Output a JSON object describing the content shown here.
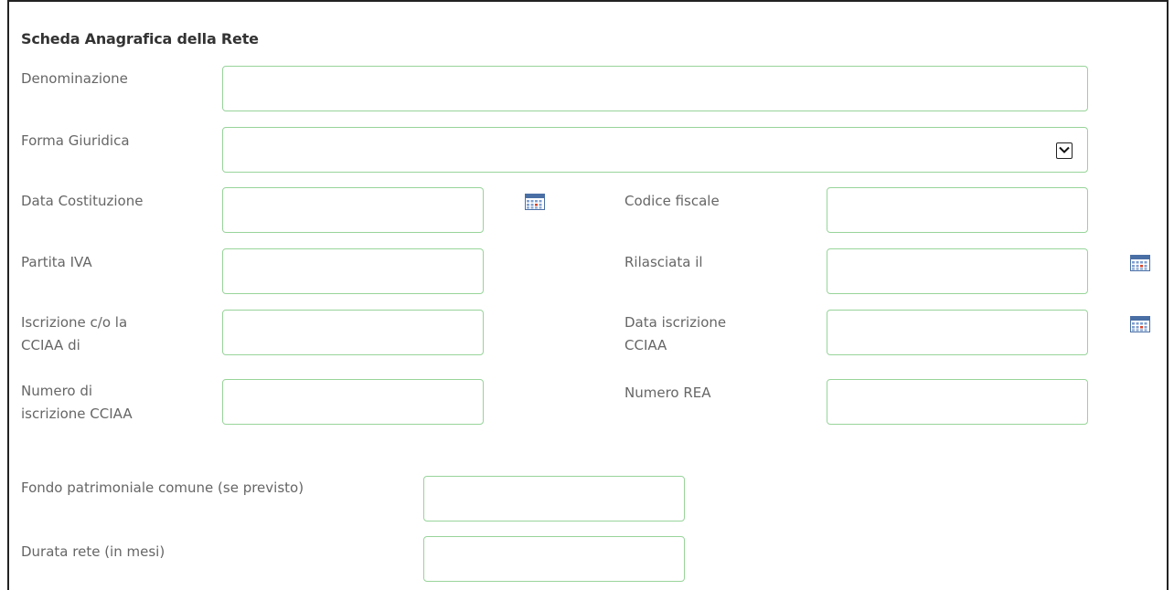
{
  "section_title": "Scheda Anagrafica della Rete",
  "fields": {
    "denominazione": {
      "label": "Denominazione",
      "value": ""
    },
    "forma_giuridica": {
      "label": "Forma Giuridica",
      "selected": ""
    },
    "data_costituzione": {
      "label": "Data Costituzione",
      "value": ""
    },
    "codice_fiscale": {
      "label": "Codice fiscale",
      "value": ""
    },
    "partita_iva": {
      "label": "Partita IVA",
      "value": ""
    },
    "rilasciata_il": {
      "label": "Rilasciata il",
      "value": ""
    },
    "iscrizione_cciaa": {
      "label_line1": "Iscrizione c/o la",
      "label_line2": "CCIAA di",
      "value": ""
    },
    "data_iscrizione_cciaa": {
      "label_line1": "Data iscrizione",
      "label_line2": "CCIAA",
      "value": ""
    },
    "numero_iscrizione_cciaa": {
      "label_line1": "Numero di",
      "label_line2": "iscrizione CCIAA",
      "value": ""
    },
    "numero_rea": {
      "label": "Numero REA",
      "value": ""
    },
    "fondo_patrimoniale": {
      "label": "Fondo patrimoniale comune (se previsto)",
      "value": ""
    },
    "durata_rete": {
      "label": "Durata rete (in mesi)",
      "value": ""
    }
  },
  "icons": {
    "calendar": "calendar-icon",
    "dropdown": "chevron-down-icon"
  },
  "colors": {
    "field_border": "#98d49a",
    "label_text": "#666666",
    "title_text": "#333333"
  }
}
